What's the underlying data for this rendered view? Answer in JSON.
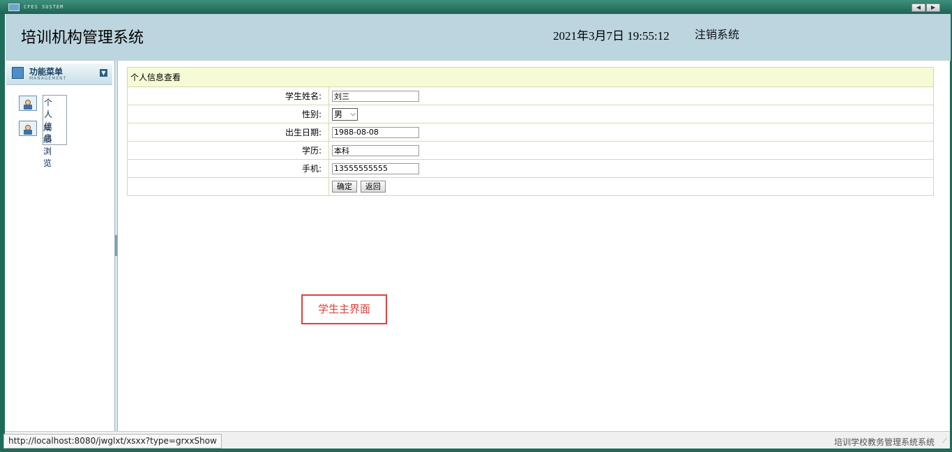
{
  "window": {
    "title": "CFES SUSTEM"
  },
  "header": {
    "title": "培训机构管理系统",
    "datetime": "2021年3月7日 19:55:12",
    "logout": "注销系统"
  },
  "sidebar": {
    "title": "功能菜单",
    "subtitle": "MANAGEMENT",
    "items": [
      {
        "label": "个人信息",
        "active": true
      },
      {
        "label": "成绩浏览",
        "active": false
      }
    ]
  },
  "form": {
    "caption": "个人信息查看",
    "fields": {
      "name": {
        "label": "学生姓名:",
        "value": "刘三"
      },
      "gender": {
        "label": "性别:",
        "value": "男"
      },
      "birth": {
        "label": "出生日期:",
        "value": "1988-08-08"
      },
      "education": {
        "label": "学历:",
        "value": "本科"
      },
      "phone": {
        "label": "手机:",
        "value": "13555555555"
      }
    },
    "confirm_label": "确定",
    "back_label": "返回"
  },
  "annotation": "学生主界面",
  "status": {
    "url": "http://localhost:8080/jwglxt/xsxx?type=grxxShow",
    "right_text": "培训学校教务管理系统系统"
  },
  "colors": {
    "header_bg": "#bcd5df",
    "frame": "#1f6b5a",
    "annotation": "#e0403b"
  }
}
